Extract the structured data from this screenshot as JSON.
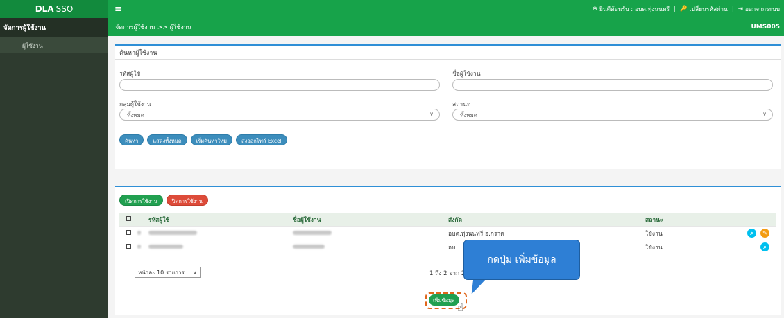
{
  "app": {
    "brand_bold": "DLA",
    "brand_rest": "SSO"
  },
  "topbar": {
    "menu_icon": "hamburger-icon",
    "welcome": "ยินดีต้อนรับ : อบต.ทุ่งนนทรี",
    "change_password": "เปลี่ยนรหัสผ่าน",
    "logout": "ออกจากระบบ"
  },
  "sidebar": {
    "header": "จัดการผู้ใช้งาน",
    "items": [
      {
        "label": "ผู้ใช้งาน"
      }
    ]
  },
  "breadcrumb": {
    "text": "จัดการผู้ใช้งาน >> ผู้ใช้งาน",
    "code": "UMS005"
  },
  "search": {
    "title": "ค้นหาผู้ใช้งาน",
    "user_id_label": "รหัสผู้ใช้",
    "user_id_value": "",
    "user_name_label": "ชื่อผู้ใช้งาน",
    "user_name_value": "",
    "group_label": "กลุ่มผู้ใช้งาน",
    "group_value": "ทั้งหมด",
    "status_label": "สถานะ",
    "status_value": "ทั้งหมด",
    "buttons": {
      "search": "ค้นหา",
      "show_all": "แสดงทั้งหมด",
      "reset": "เริ่มค้นหาใหม่",
      "export": "ส่งออกไฟล์ Excel"
    }
  },
  "results": {
    "enable_button": "เปิดการใช้งาน",
    "disable_button": "ปิดการใช้งาน",
    "columns": {
      "id": "รหัสผู้ใช้",
      "name": "ชื่อผู้ใช้งาน",
      "dept": "สังกัด",
      "status": "สถานะ"
    },
    "rows": [
      {
        "dept": "อบต.ทุ่งนนทรี อ.กราด",
        "status": "ใช้งาน"
      },
      {
        "dept": "อบ",
        "status": "ใช้งาน"
      }
    ],
    "page_size": "หน้าละ 10 รายการ",
    "page_info": "1 ถึง 2 จาก 2",
    "add_button": "เพิ่มข้อมูล"
  },
  "callout": {
    "text": "กดปุ่ม เพิ่มข้อมูล"
  },
  "colors": {
    "green": "#17a34a",
    "blue_accent": "#2f8fd6",
    "sidebar": "#2e3b2f",
    "callout": "#2e7fd5",
    "highlight": "#e0661b"
  }
}
